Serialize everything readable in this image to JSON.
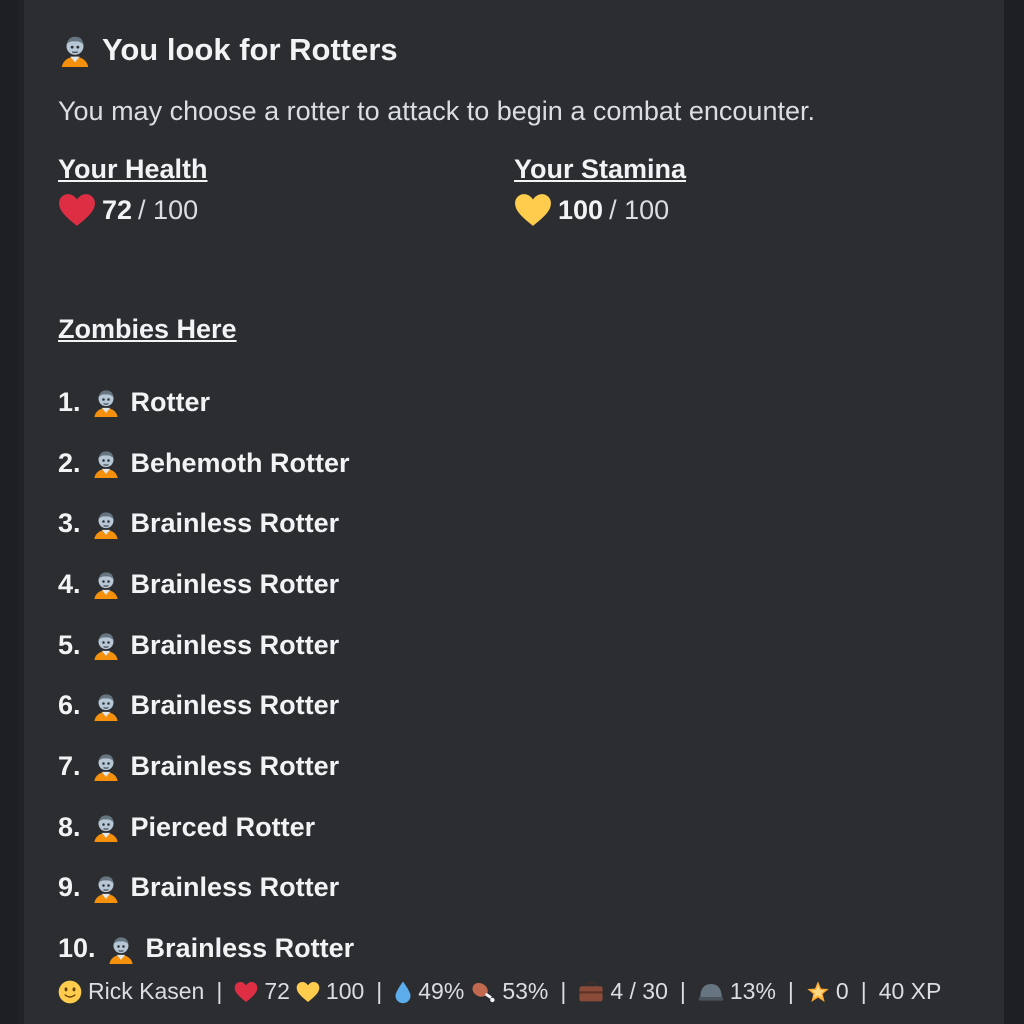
{
  "title": "You look for Rotters",
  "description": "You may choose a rotter to attack to begin a combat encounter.",
  "health": {
    "label": "Your Health",
    "current": "72",
    "max": "/ 100",
    "icon": "red-heart-icon",
    "color": "#dd2e44"
  },
  "stamina": {
    "label": "Your Stamina",
    "current": "100",
    "max": "/ 100",
    "icon": "yellow-heart-icon",
    "color": "#ffcc4d"
  },
  "zombies_heading": "Zombies Here",
  "zombies": [
    {
      "num": "1.",
      "name": "Rotter"
    },
    {
      "num": "2.",
      "name": "Behemoth Rotter"
    },
    {
      "num": "3.",
      "name": "Brainless Rotter"
    },
    {
      "num": "4.",
      "name": "Brainless Rotter"
    },
    {
      "num": "5.",
      "name": "Brainless Rotter"
    },
    {
      "num": "6.",
      "name": "Brainless Rotter"
    },
    {
      "num": "7.",
      "name": "Brainless Rotter"
    },
    {
      "num": "8.",
      "name": "Pierced Rotter"
    },
    {
      "num": "9.",
      "name": "Brainless Rotter"
    },
    {
      "num": "10.",
      "name": "Brainless Rotter"
    }
  ],
  "footer": {
    "name": "Rick Kasen",
    "health": "72",
    "stamina": "100",
    "water": "49%",
    "food": "53%",
    "inventory": "4 / 30",
    "armor": "13%",
    "stars": "0",
    "xp": "40 XP",
    "separator": "|"
  }
}
